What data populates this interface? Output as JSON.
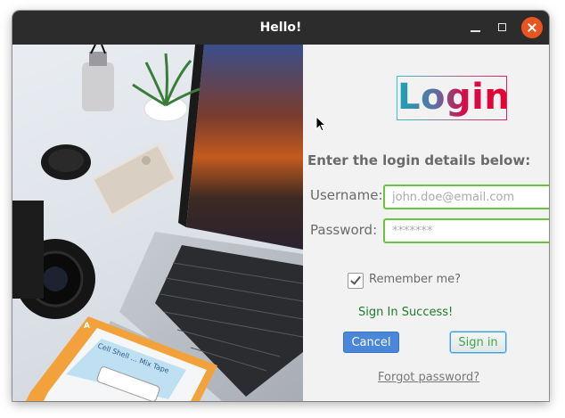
{
  "window": {
    "title": "Hello!"
  },
  "colors": {
    "titlebar": "#2c2c2c",
    "close_button": "#e95420",
    "field_border": "#6ac43a",
    "cancel_button": "#4a86d9",
    "status_text": "#1e7b2a"
  },
  "icons": [
    "minimize-icon",
    "maximize-icon",
    "close-icon",
    "checkmark-icon",
    "mouse-pointer-icon"
  ],
  "login": {
    "logo": "Login",
    "heading": "Enter the login details below:",
    "username_label": "Username:",
    "username_placeholder": "john.doe@email.com",
    "username_value": "",
    "password_label": "Password:",
    "password_placeholder": "*******",
    "password_value": "",
    "remember_label": "Remember me?",
    "remember_checked": true,
    "status": "Sign In Success!",
    "cancel_label": "Cancel",
    "signin_label": "Sign in",
    "forgot_label": "Forgot password?"
  },
  "photo": {
    "cassette_label": "Cell Shell ... Mix Tape",
    "cassette_side": "A"
  }
}
